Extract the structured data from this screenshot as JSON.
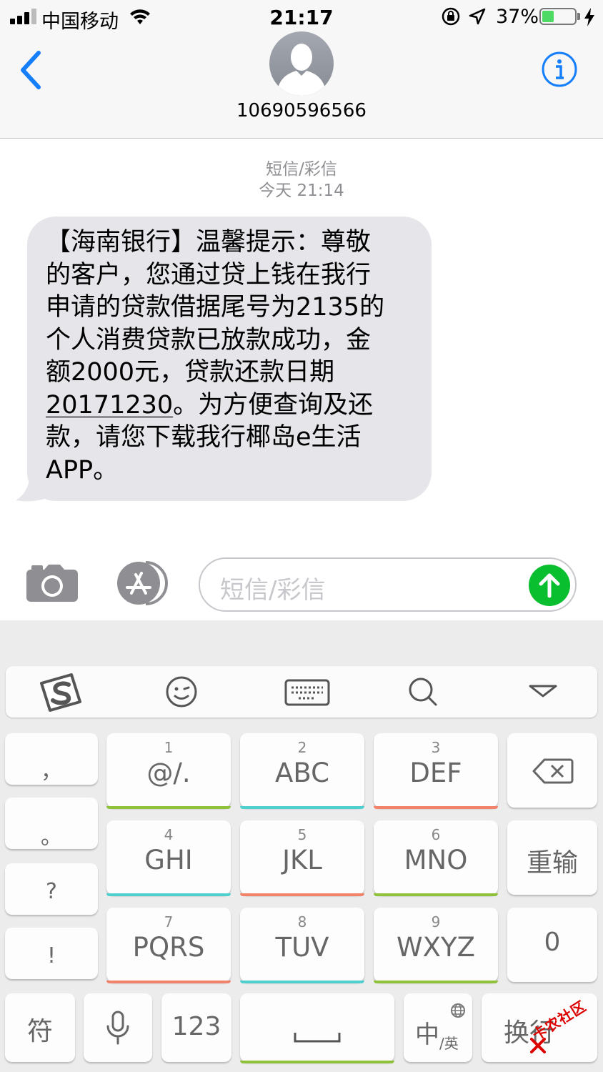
{
  "status_bar": {
    "carrier": "中国移动",
    "time": "21:17",
    "battery_percent": "37%",
    "battery_level": 0.37
  },
  "header": {
    "contact": "10690596566"
  },
  "messages": {
    "service_label": "短信/彩信",
    "timestamp": "今天 21:14",
    "bubble_lines": [
      "【海南银行】温馨提示：尊敬",
      "的客户，您通过贷上钱在我行",
      "申请的贷款借据尾号为2135的",
      "个人消费贷款已放款成功，金",
      "额2000元，贷款还款日期"
    ],
    "bubble_date": "20171230",
    "bubble_line6_rest": "。为方便查询及还",
    "bubble_line7": "款，请您下载我行椰岛e生活",
    "bubble_line8": "APP。"
  },
  "input": {
    "placeholder": "短信/彩信"
  },
  "keyboard": {
    "punct_keys": [
      "，",
      "。",
      "?",
      "!"
    ],
    "keys": [
      {
        "num": "1",
        "label": "@/.",
        "bar": "#8fc23a"
      },
      {
        "num": "2",
        "label": "ABC",
        "bar": "#4fd0cf"
      },
      {
        "num": "3",
        "label": "DEF",
        "bar": "#f0836a"
      },
      {
        "num": "4",
        "label": "GHI",
        "bar": "#4fd0cf"
      },
      {
        "num": "5",
        "label": "JKL",
        "bar": "#f0836a"
      },
      {
        "num": "6",
        "label": "MNO",
        "bar": "#8fc23a"
      },
      {
        "num": "7",
        "label": "PQRS",
        "bar": "#f0836a"
      },
      {
        "num": "8",
        "label": "TUV",
        "bar": "#4fd0cf"
      },
      {
        "num": "9",
        "label": "WXYZ",
        "bar": "#8fc23a"
      }
    ],
    "retype_label": "重输",
    "zero_label": "0",
    "symbol_label": "符",
    "num_label": "123",
    "lang_main": "中",
    "lang_sub": "/英",
    "return_label": "换行",
    "space_bar_color": "#8fc23a"
  },
  "watermark": "卡农社区",
  "colors": {
    "ios_blue": "#157efb",
    "send_green": "#0abf2f",
    "bubble_gray": "#e5e5ea"
  }
}
